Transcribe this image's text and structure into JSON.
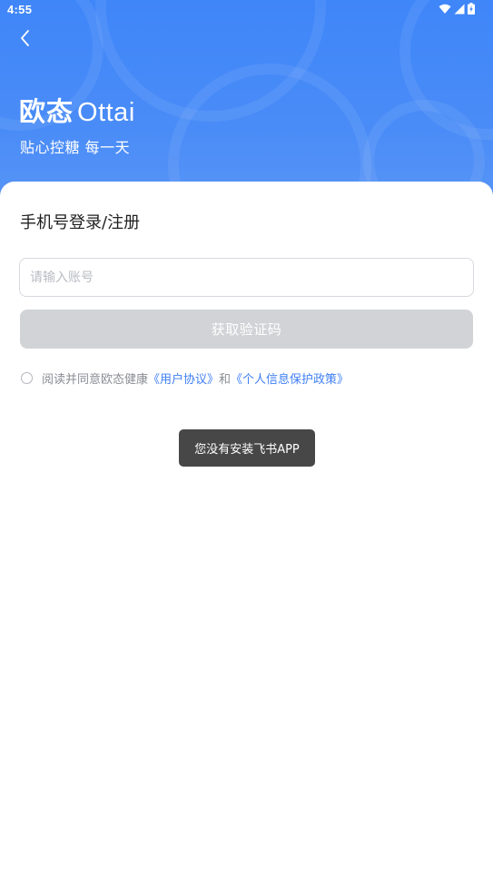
{
  "status_bar": {
    "time": "4:55"
  },
  "header": {
    "back_icon": "chevron-left-icon",
    "brand_cn": "欧态",
    "brand_en": "Ottai",
    "slogan": "贴心控糖 每一天"
  },
  "login": {
    "title": "手机号登录/注册",
    "account_placeholder": "请输入账号",
    "get_code_label": "获取验证码",
    "agreement_prefix": "阅读并同意欧态健康",
    "user_agreement_link": "《用户协议》",
    "agreement_and": "和",
    "privacy_policy_link": "《个人信息保护政策》"
  },
  "toast": {
    "message": "您没有安装飞书APP"
  },
  "colors": {
    "header_blue": "#3f86f9",
    "link_blue": "#3f7ff5",
    "button_disabled": "#d2d3d6",
    "toast_bg": "#474747"
  }
}
